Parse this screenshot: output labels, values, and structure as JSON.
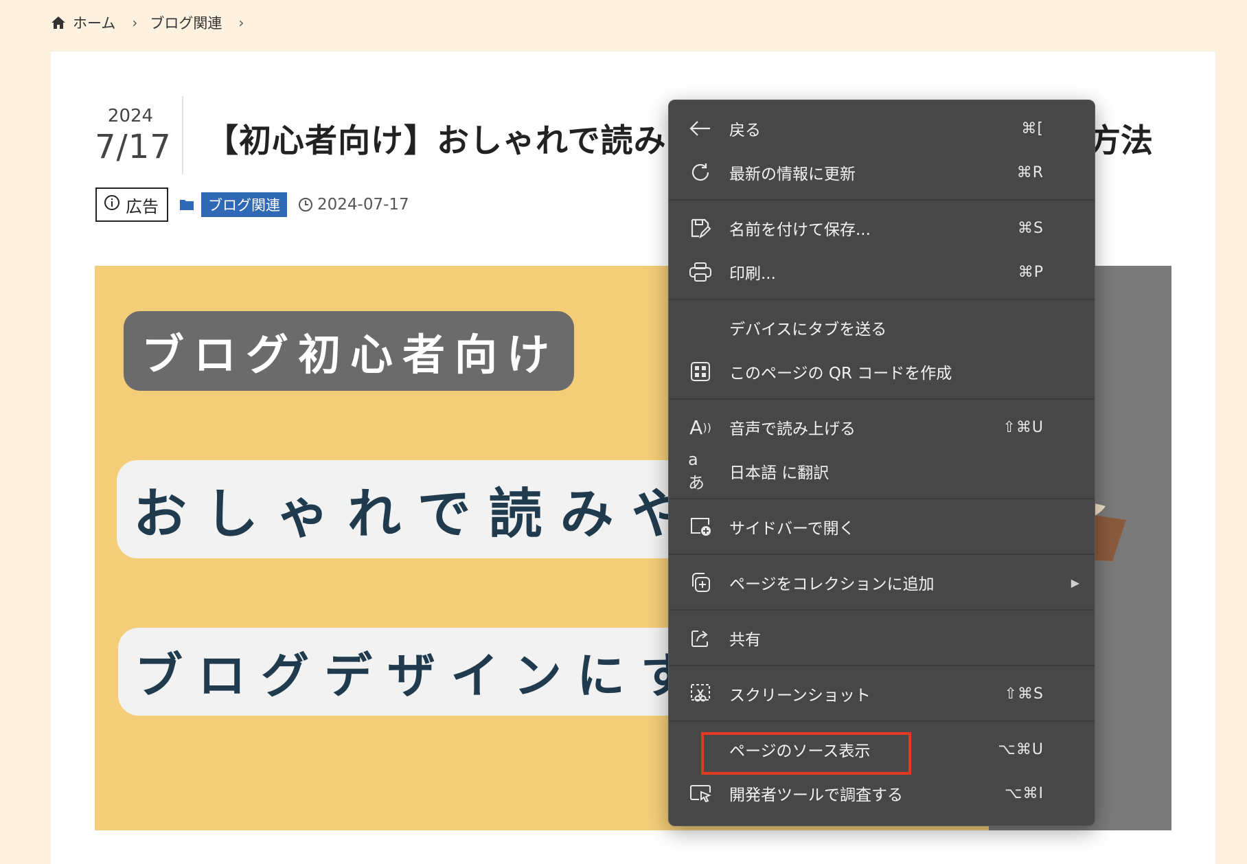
{
  "breadcrumb": {
    "home": "ホーム",
    "category": "ブログ関連"
  },
  "post": {
    "year": "2024",
    "month_day": "7/17",
    "title_visible": "【初心者向け】おしゃれで読み",
    "title_tail": "方法",
    "ad_label": "広告",
    "category": "ブログ関連",
    "date": "2024-07-17"
  },
  "hero": {
    "line1": "ブログ初心者向け",
    "line2": "おしゃれで読みや",
    "line3": "ブログデザインにす"
  },
  "context_menu": {
    "items": [
      {
        "icon": "back-arrow-icon",
        "label": "戻る",
        "shortcut": "⌘["
      },
      {
        "icon": "refresh-icon",
        "label": "最新の情報に更新",
        "shortcut": "⌘R"
      },
      {
        "icon": "save-icon",
        "label": "名前を付けて保存...",
        "shortcut": "⌘S"
      },
      {
        "icon": "print-icon",
        "label": "印刷...",
        "shortcut": "⌘P"
      },
      {
        "icon": "",
        "label": "デバイスにタブを送る",
        "shortcut": ""
      },
      {
        "icon": "qr-code-icon",
        "label": "このページの QR コードを作成",
        "shortcut": ""
      },
      {
        "icon": "read-aloud-icon",
        "label": "音声で読み上げる",
        "shortcut": "⇧⌘U"
      },
      {
        "icon": "translate-icon",
        "label": "日本語 に翻訳",
        "shortcut": ""
      },
      {
        "icon": "sidebar-add-icon",
        "label": "サイドバーで開く",
        "shortcut": ""
      },
      {
        "icon": "collections-icon",
        "label": "ページをコレクションに追加",
        "shortcut": ""
      },
      {
        "icon": "share-icon",
        "label": "共有",
        "shortcut": ""
      },
      {
        "icon": "screenshot-icon",
        "label": "スクリーンショット",
        "shortcut": "⇧⌘S"
      },
      {
        "icon": "",
        "label": "ページのソース表示",
        "shortcut": "⌥⌘U"
      },
      {
        "icon": "inspect-icon",
        "label": "開発者ツールで調査する",
        "shortcut": "⌥⌘I"
      }
    ],
    "highlight_color": "#e23a22"
  },
  "colors": {
    "page_bg": "#fcf2df",
    "menu_bg": "#474747",
    "category_tag": "#2f68b4",
    "hero_bg": "#f4cd78"
  }
}
